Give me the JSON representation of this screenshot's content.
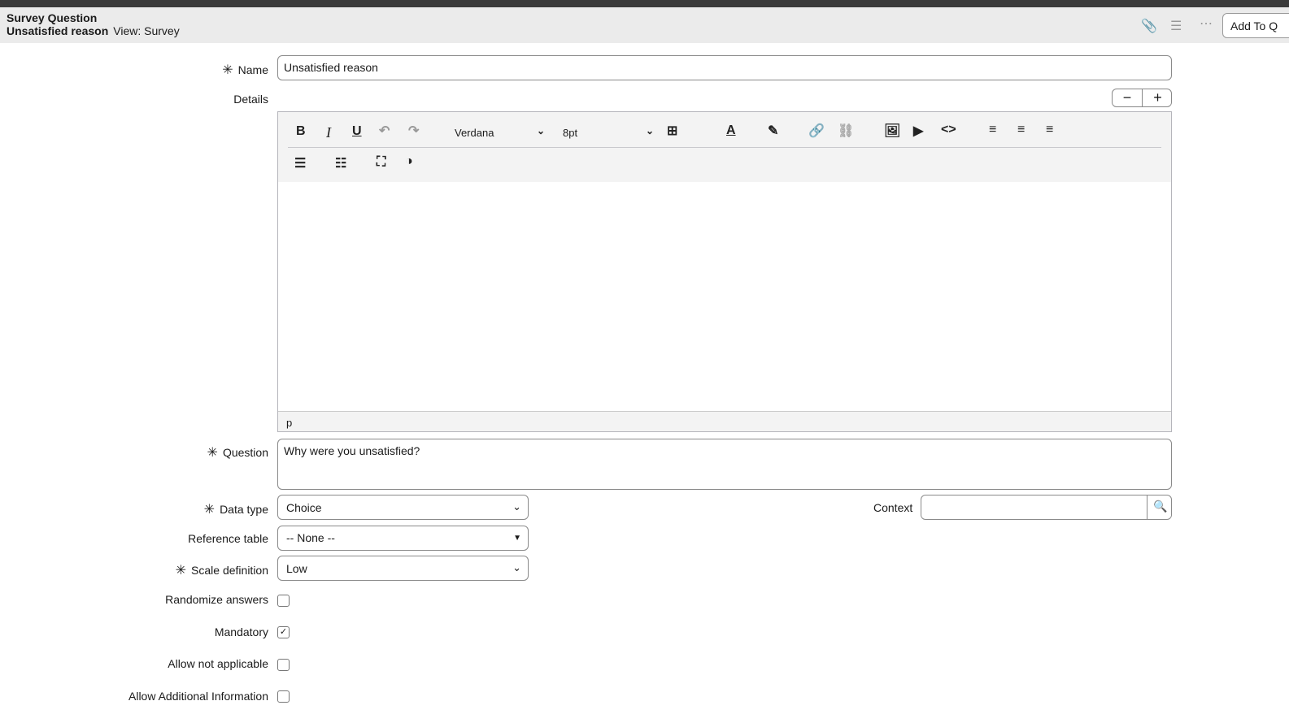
{
  "header": {
    "title": "Survey Question",
    "record": "Unsatisfied reason",
    "view": "View: Survey",
    "add_button": "Add To Q"
  },
  "form": {
    "name": {
      "label": "Name",
      "value": "Unsatisfied reason"
    },
    "details": {
      "label": "Details"
    },
    "editor": {
      "font": "Verdana",
      "size": "8pt",
      "status": "p"
    },
    "question": {
      "label": "Question",
      "value": "Why were you unsatisfied?"
    },
    "data_type": {
      "label": "Data type",
      "value": "Choice"
    },
    "context": {
      "label": "Context",
      "value": ""
    },
    "reference_table": {
      "label": "Reference table",
      "value": "-- None --"
    },
    "scale_definition": {
      "label": "Scale definition",
      "value": "Low"
    },
    "randomize": {
      "label": "Randomize answers",
      "checked": false
    },
    "mandatory": {
      "label": "Mandatory",
      "checked": true
    },
    "allow_na": {
      "label": "Allow not applicable",
      "checked": false
    },
    "allow_info": {
      "label": "Allow Additional Information",
      "checked": false
    }
  }
}
